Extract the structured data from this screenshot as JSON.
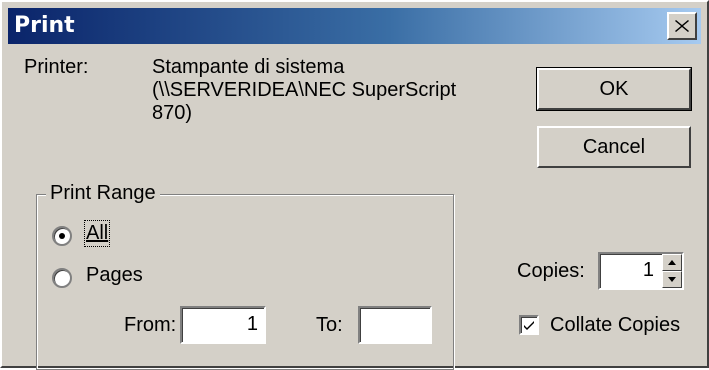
{
  "window": {
    "title": "Print"
  },
  "printer": {
    "label": "Printer:",
    "name_lines": [
      "Stampante di sistema",
      "(\\\\SERVERIDEA\\NEC SuperScript",
      "870)"
    ]
  },
  "buttons": {
    "ok": "OK",
    "cancel": "Cancel"
  },
  "print_range": {
    "legend": "Print Range",
    "all_label": "All",
    "pages_label": "Pages",
    "selected": "All",
    "from_label": "From:",
    "from_value": "1",
    "to_label": "To:",
    "to_value": ""
  },
  "copies": {
    "label": "Copies:",
    "value": "1"
  },
  "collate": {
    "label": "Collate Copies",
    "checked": true
  },
  "colors": {
    "face": "#d4d0c8",
    "title_start": "#0a246a",
    "title_end": "#a6caf0"
  }
}
